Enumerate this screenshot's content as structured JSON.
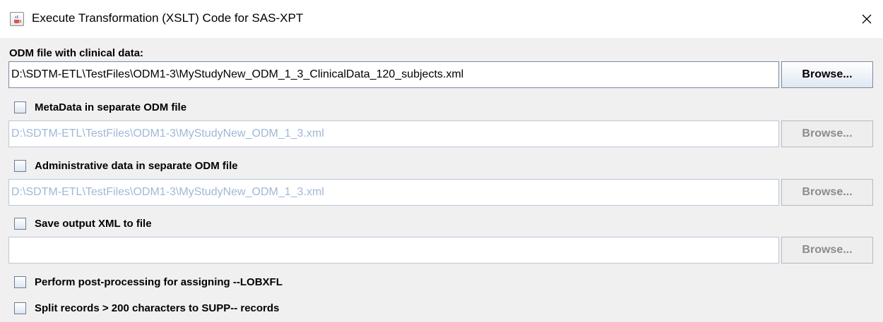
{
  "window": {
    "title": "Execute Transformation (XSLT) Code for SAS-XPT",
    "icon": "java-cup-icon",
    "close_icon": "close-icon"
  },
  "clinical": {
    "label": "ODM file with clinical data:",
    "path": "D:\\SDTM-ETL\\TestFiles\\ODM1-3\\MyStudyNew_ODM_1_3_ClinicalData_120_subjects.xml",
    "browse_label": "Browse..."
  },
  "metadata": {
    "checkbox_label": "MetaData in separate ODM file",
    "checked": false,
    "path": "D:\\SDTM-ETL\\TestFiles\\ODM1-3\\MyStudyNew_ODM_1_3.xml",
    "browse_label": "Browse..."
  },
  "admin": {
    "checkbox_label": "Administrative data in separate ODM file",
    "checked": false,
    "path": "D:\\SDTM-ETL\\TestFiles\\ODM1-3\\MyStudyNew_ODM_1_3.xml",
    "browse_label": "Browse..."
  },
  "output": {
    "checkbox_label": "Save output XML to file",
    "checked": false,
    "path": "",
    "browse_label": "Browse..."
  },
  "postprocess": {
    "checkbox_label": "Perform post-processing for assigning --LOBXFL",
    "checked": false
  },
  "split": {
    "checkbox_label": "Split records > 200 characters to SUPP-- records",
    "checked": false
  },
  "colors": {
    "disabled_text": "#9fb8d6",
    "border": "#7a8aa0",
    "background": "#f0f0f0"
  }
}
